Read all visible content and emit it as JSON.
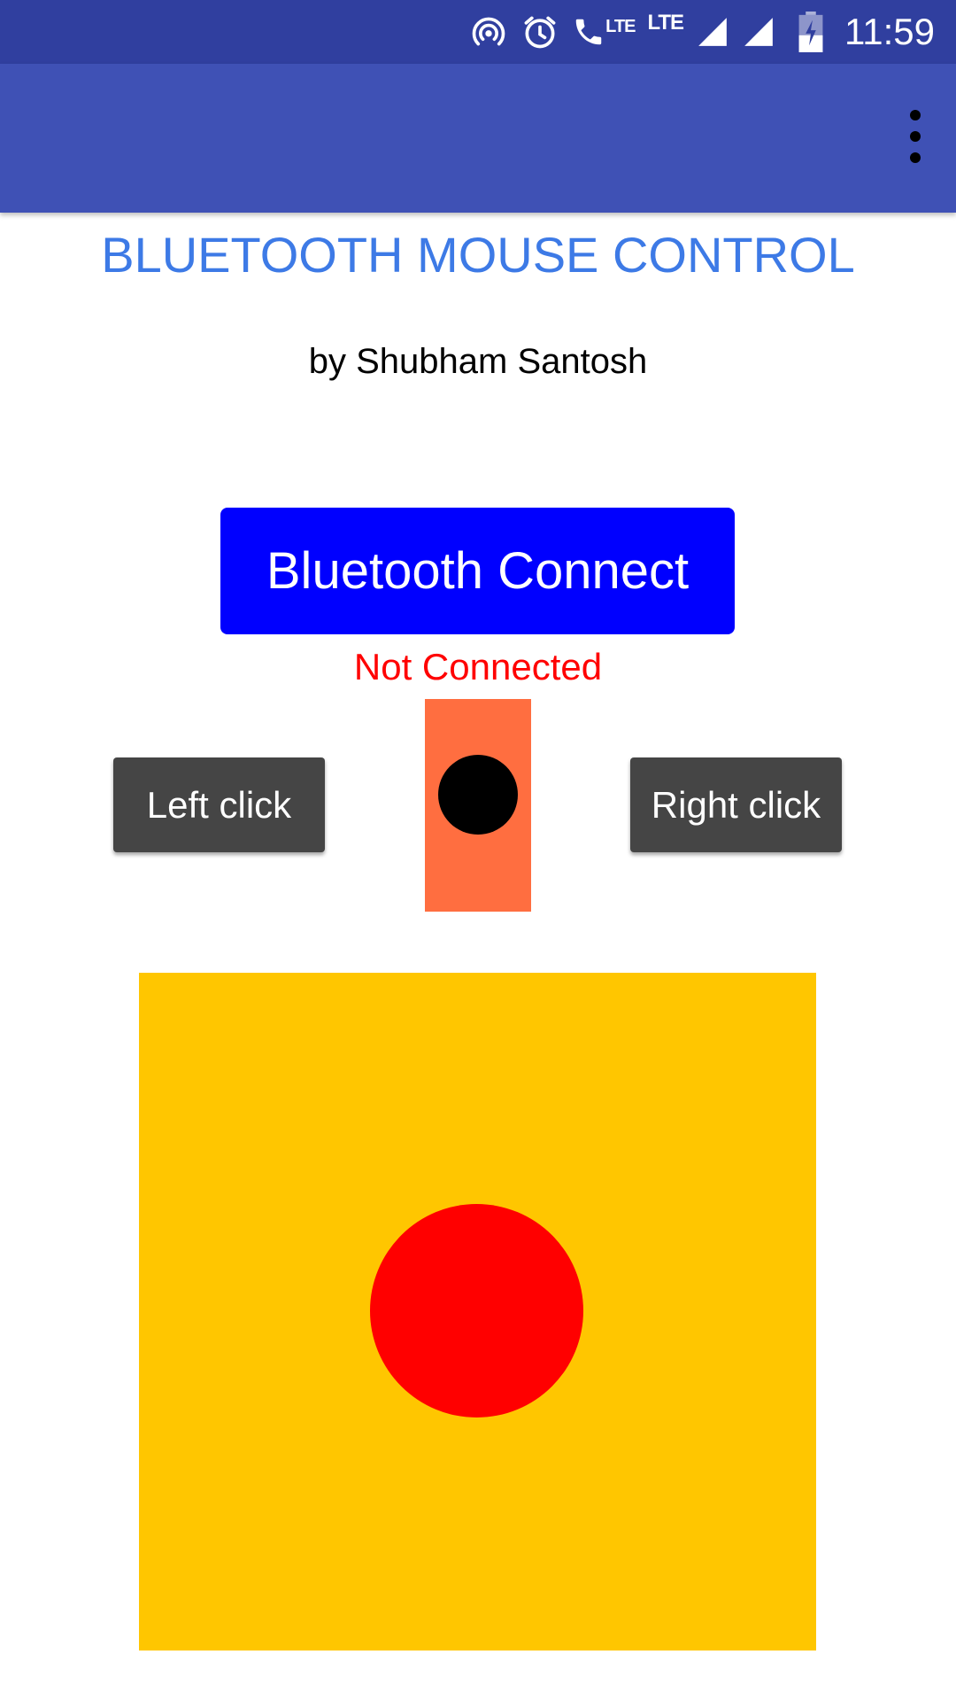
{
  "status_bar": {
    "time": "11:59",
    "lte_label_1": "LTE",
    "lte_label_2": "LTE",
    "icons": [
      "hotspot-icon",
      "alarm-icon",
      "volte-call-icon",
      "signal-icon",
      "signal-icon",
      "battery-charging-icon"
    ],
    "background_color": "#303f9f"
  },
  "app_bar": {
    "background_color": "#3f51b5",
    "menu_icon": "more-vert-icon"
  },
  "main": {
    "title": "BLUETOOTH MOUSE CONTROL",
    "title_color": "#3d7ae6",
    "author": "by Shubham Santosh",
    "connect_button_label": "Bluetooth Connect",
    "connect_button_color": "#0000ff",
    "connection_status": "Not Connected",
    "connection_status_color": "#ff0000",
    "left_click_label": "Left click",
    "right_click_label": "Right click",
    "scroll_strip_color": "#ff6e40",
    "touchpad_color": "#ffc600",
    "touchpad_knob_color": "#ff0000"
  }
}
